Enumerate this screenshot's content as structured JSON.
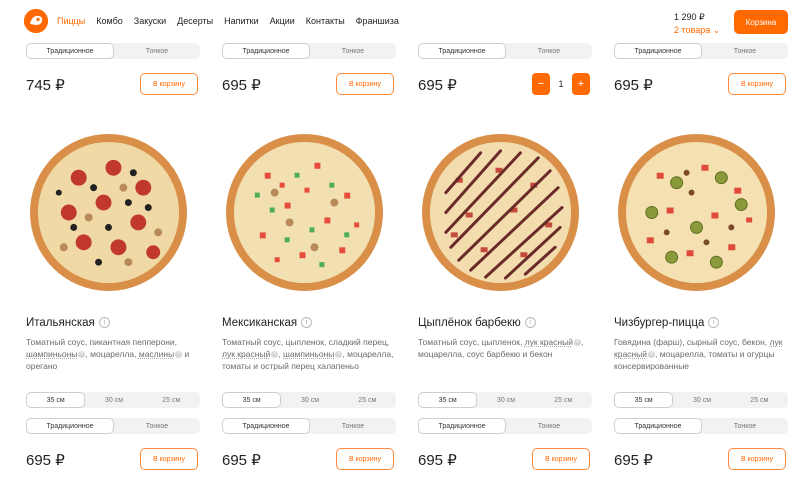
{
  "header": {
    "brand_color": "#ff6900",
    "logo_icon": "dodo-logo-icon",
    "nav": [
      "Пиццы",
      "Комбо",
      "Закуски",
      "Десерты",
      "Напитки",
      "Акции",
      "Контакты",
      "Франшиза"
    ],
    "cart_total": "1 290 ₽",
    "cart_count": "2 товара",
    "cart_button": "Корзина"
  },
  "top_row": [
    {
      "dough": [
        "Традиционное",
        "Тонкое"
      ],
      "price": "745 ₽",
      "button": "В корзину"
    },
    {
      "dough": [
        "Традиционное",
        "Тонкое"
      ],
      "price": "695 ₽",
      "button": "В корзину"
    },
    {
      "dough": [
        "Традиционное",
        "Тонкое"
      ],
      "price": "695 ₽",
      "stepper": {
        "minus": "−",
        "qty": "1",
        "plus": "+"
      }
    },
    {
      "dough": [
        "Традиционное",
        "Тонкое"
      ],
      "price": "695 ₽",
      "button": "В корзину"
    }
  ],
  "products": [
    {
      "name": "Итальянская",
      "desc": [
        "Томатный соус, пикантная пепперони, ",
        "шампиньоны",
        ", моцарелла, ",
        "маслины",
        " и орегано"
      ],
      "sizes": [
        "35 см",
        "30 см",
        "25 см"
      ],
      "dough": [
        "Традиционное",
        "Тонкое"
      ],
      "price": "695 ₽",
      "button": "В корзину"
    },
    {
      "name": "Мексиканская",
      "desc": [
        "Томатный соус, цыпленок, сладкий перец, ",
        "лук красный",
        ", ",
        "шампиньоны",
        ", моцарелла, томаты и острый перец халапеньо"
      ],
      "sizes": [
        "35 см",
        "30 см",
        "25 см"
      ],
      "dough": [
        "Традиционное",
        "Тонкое"
      ],
      "price": "695 ₽",
      "button": "В корзину"
    },
    {
      "name": "Цыплёнок барбекю",
      "desc": [
        "Томатный соус, цыпленок, ",
        "лук красный",
        ", моцарелла, соус барбекю и бекон"
      ],
      "sizes": [
        "35 см",
        "30 см",
        "25 см"
      ],
      "dough": [
        "Традиционное",
        "Тонкое"
      ],
      "price": "695 ₽",
      "button": "В корзину"
    },
    {
      "name": "Чизбургер-пицца",
      "desc": [
        "Говядина (фарш), сырный соус, бекон, ",
        "лук красный",
        ", моцарелла, томаты и огурцы консервированные"
      ],
      "sizes": [
        "35 см",
        "30 см",
        "25 см"
      ],
      "dough": [
        "Традиционное",
        "Тонкое"
      ],
      "price": "695 ₽",
      "button": "В корзину"
    }
  ]
}
